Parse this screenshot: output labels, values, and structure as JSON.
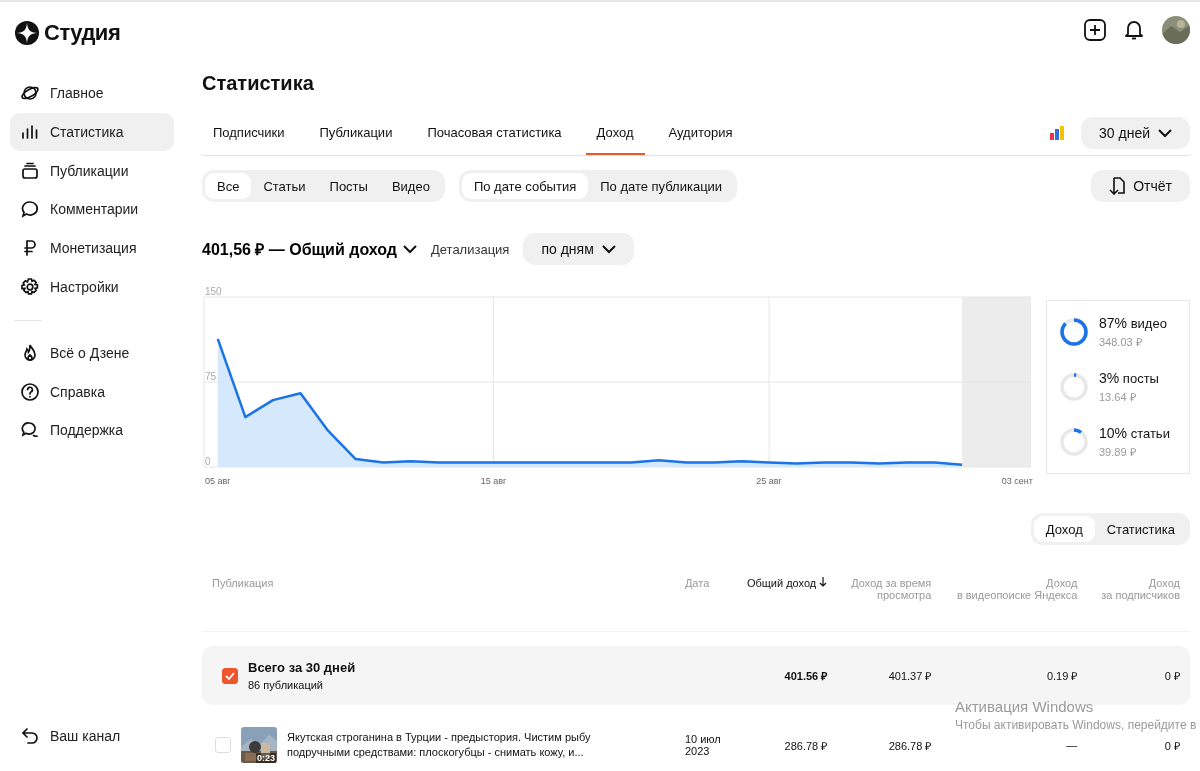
{
  "logo": {
    "title": "Студия"
  },
  "sidebar": {
    "items": [
      {
        "label": "Главное",
        "kind": "planet",
        "selected": false
      },
      {
        "label": "Статистика",
        "kind": "bars",
        "selected": true
      },
      {
        "label": "Публикации",
        "kind": "stack",
        "selected": false
      },
      {
        "label": "Комментарии",
        "kind": "bubble",
        "selected": false
      },
      {
        "label": "Монетизация",
        "kind": "ruble",
        "selected": false
      },
      {
        "label": "Настройки",
        "kind": "gear",
        "selected": false
      }
    ],
    "secondary_items": [
      {
        "label": "Всё о Дзене",
        "kind": "flame",
        "selected": false
      },
      {
        "label": "Справка",
        "kind": "help",
        "selected": false
      },
      {
        "label": "Поддержка",
        "kind": "chat",
        "selected": false
      }
    ],
    "footer_item": {
      "label": "Ваш канал",
      "kind": "back"
    }
  },
  "page": {
    "title": "Статистика"
  },
  "tabs": [
    {
      "label": "Подписчики",
      "selected": false
    },
    {
      "label": "Публикации",
      "selected": false
    },
    {
      "label": "Почасовая статистика",
      "selected": false
    },
    {
      "label": "Доход",
      "selected": true
    },
    {
      "label": "Аудитория",
      "selected": false
    }
  ],
  "period": {
    "value": "30 дней"
  },
  "type_filter": [
    {
      "label": "Все",
      "selected": true
    },
    {
      "label": "Статьи",
      "selected": false
    },
    {
      "label": "Посты",
      "selected": false
    },
    {
      "label": "Видео",
      "selected": false
    }
  ],
  "date_filter": [
    {
      "label": "По дате события",
      "selected": true
    },
    {
      "label": "По дате публикации",
      "selected": false
    }
  ],
  "report_button": {
    "label": "Отчёт"
  },
  "summary": {
    "total": "401,56 ₽ — Общий доход",
    "detail_label": "Детализация",
    "detail_value": "по дням"
  },
  "chart_data": {
    "type": "area",
    "grid": true,
    "categories": [
      "05 авг",
      null,
      null,
      null,
      null,
      null,
      null,
      null,
      null,
      null,
      "15 авг",
      null,
      null,
      null,
      null,
      null,
      null,
      null,
      null,
      null,
      "25 авг",
      null,
      null,
      null,
      null,
      null,
      null,
      null,
      null,
      "03 сент"
    ],
    "series": [
      {
        "color": "#1a73e8",
        "values": [
          113,
          44,
          59,
          65,
          32,
          7,
          4,
          5,
          4,
          4,
          4,
          4,
          4,
          4,
          4,
          4,
          6,
          4,
          4,
          5,
          4,
          3,
          4,
          4,
          3,
          4,
          4,
          2,
          null,
          null
        ]
      }
    ],
    "ylim": [
      0,
      150
    ],
    "yticks": [
      0,
      75,
      150
    ]
  },
  "breakdown": [
    {
      "percent": "87%",
      "name": "видео",
      "amount": "348.03 ₽"
    },
    {
      "percent": "3%",
      "name": "посты",
      "amount": "13.64 ₽"
    },
    {
      "percent": "10%",
      "name": "статьи",
      "amount": "39.89 ₽"
    }
  ],
  "table_view": [
    {
      "label": "Доход",
      "selected": true
    },
    {
      "label": "Статистика",
      "selected": false
    }
  ],
  "table": {
    "columns": [
      {
        "label": "Публикация",
        "sorted": false
      },
      {
        "label": "Дата",
        "sorted": false
      },
      {
        "label": "Общий доход",
        "sorted": true
      },
      {
        "label": "Доход за время\nпросмотра",
        "sorted": false
      },
      {
        "label": "Доход\nв видеопоиске Яндекса",
        "sorted": false
      },
      {
        "label": "Доход\nза подписчиков",
        "sorted": false
      }
    ],
    "total_row": {
      "checked": true,
      "subtitle": "86 публикаций",
      "cells": [
        "Всего за 30 дней",
        "",
        "401.56 ₽",
        "401.37 ₽",
        "0.19 ₽",
        "0 ₽"
      ]
    },
    "rows": [
      {
        "checked": false,
        "kind": "picture",
        "duration": "0:23",
        "cells": [
          "Якутская строганина в Турции - предыстория. Чистим рыбу подручными средствами: плоскогубцы - снимать кожу, и...",
          "10 июл\n2023",
          "286.78 ₽",
          "286.78 ₽",
          "—",
          "0 ₽"
        ]
      }
    ]
  },
  "windows_notice": {
    "title": "Активация Windows",
    "text": "Чтобы активировать Windows, перейдите в"
  }
}
